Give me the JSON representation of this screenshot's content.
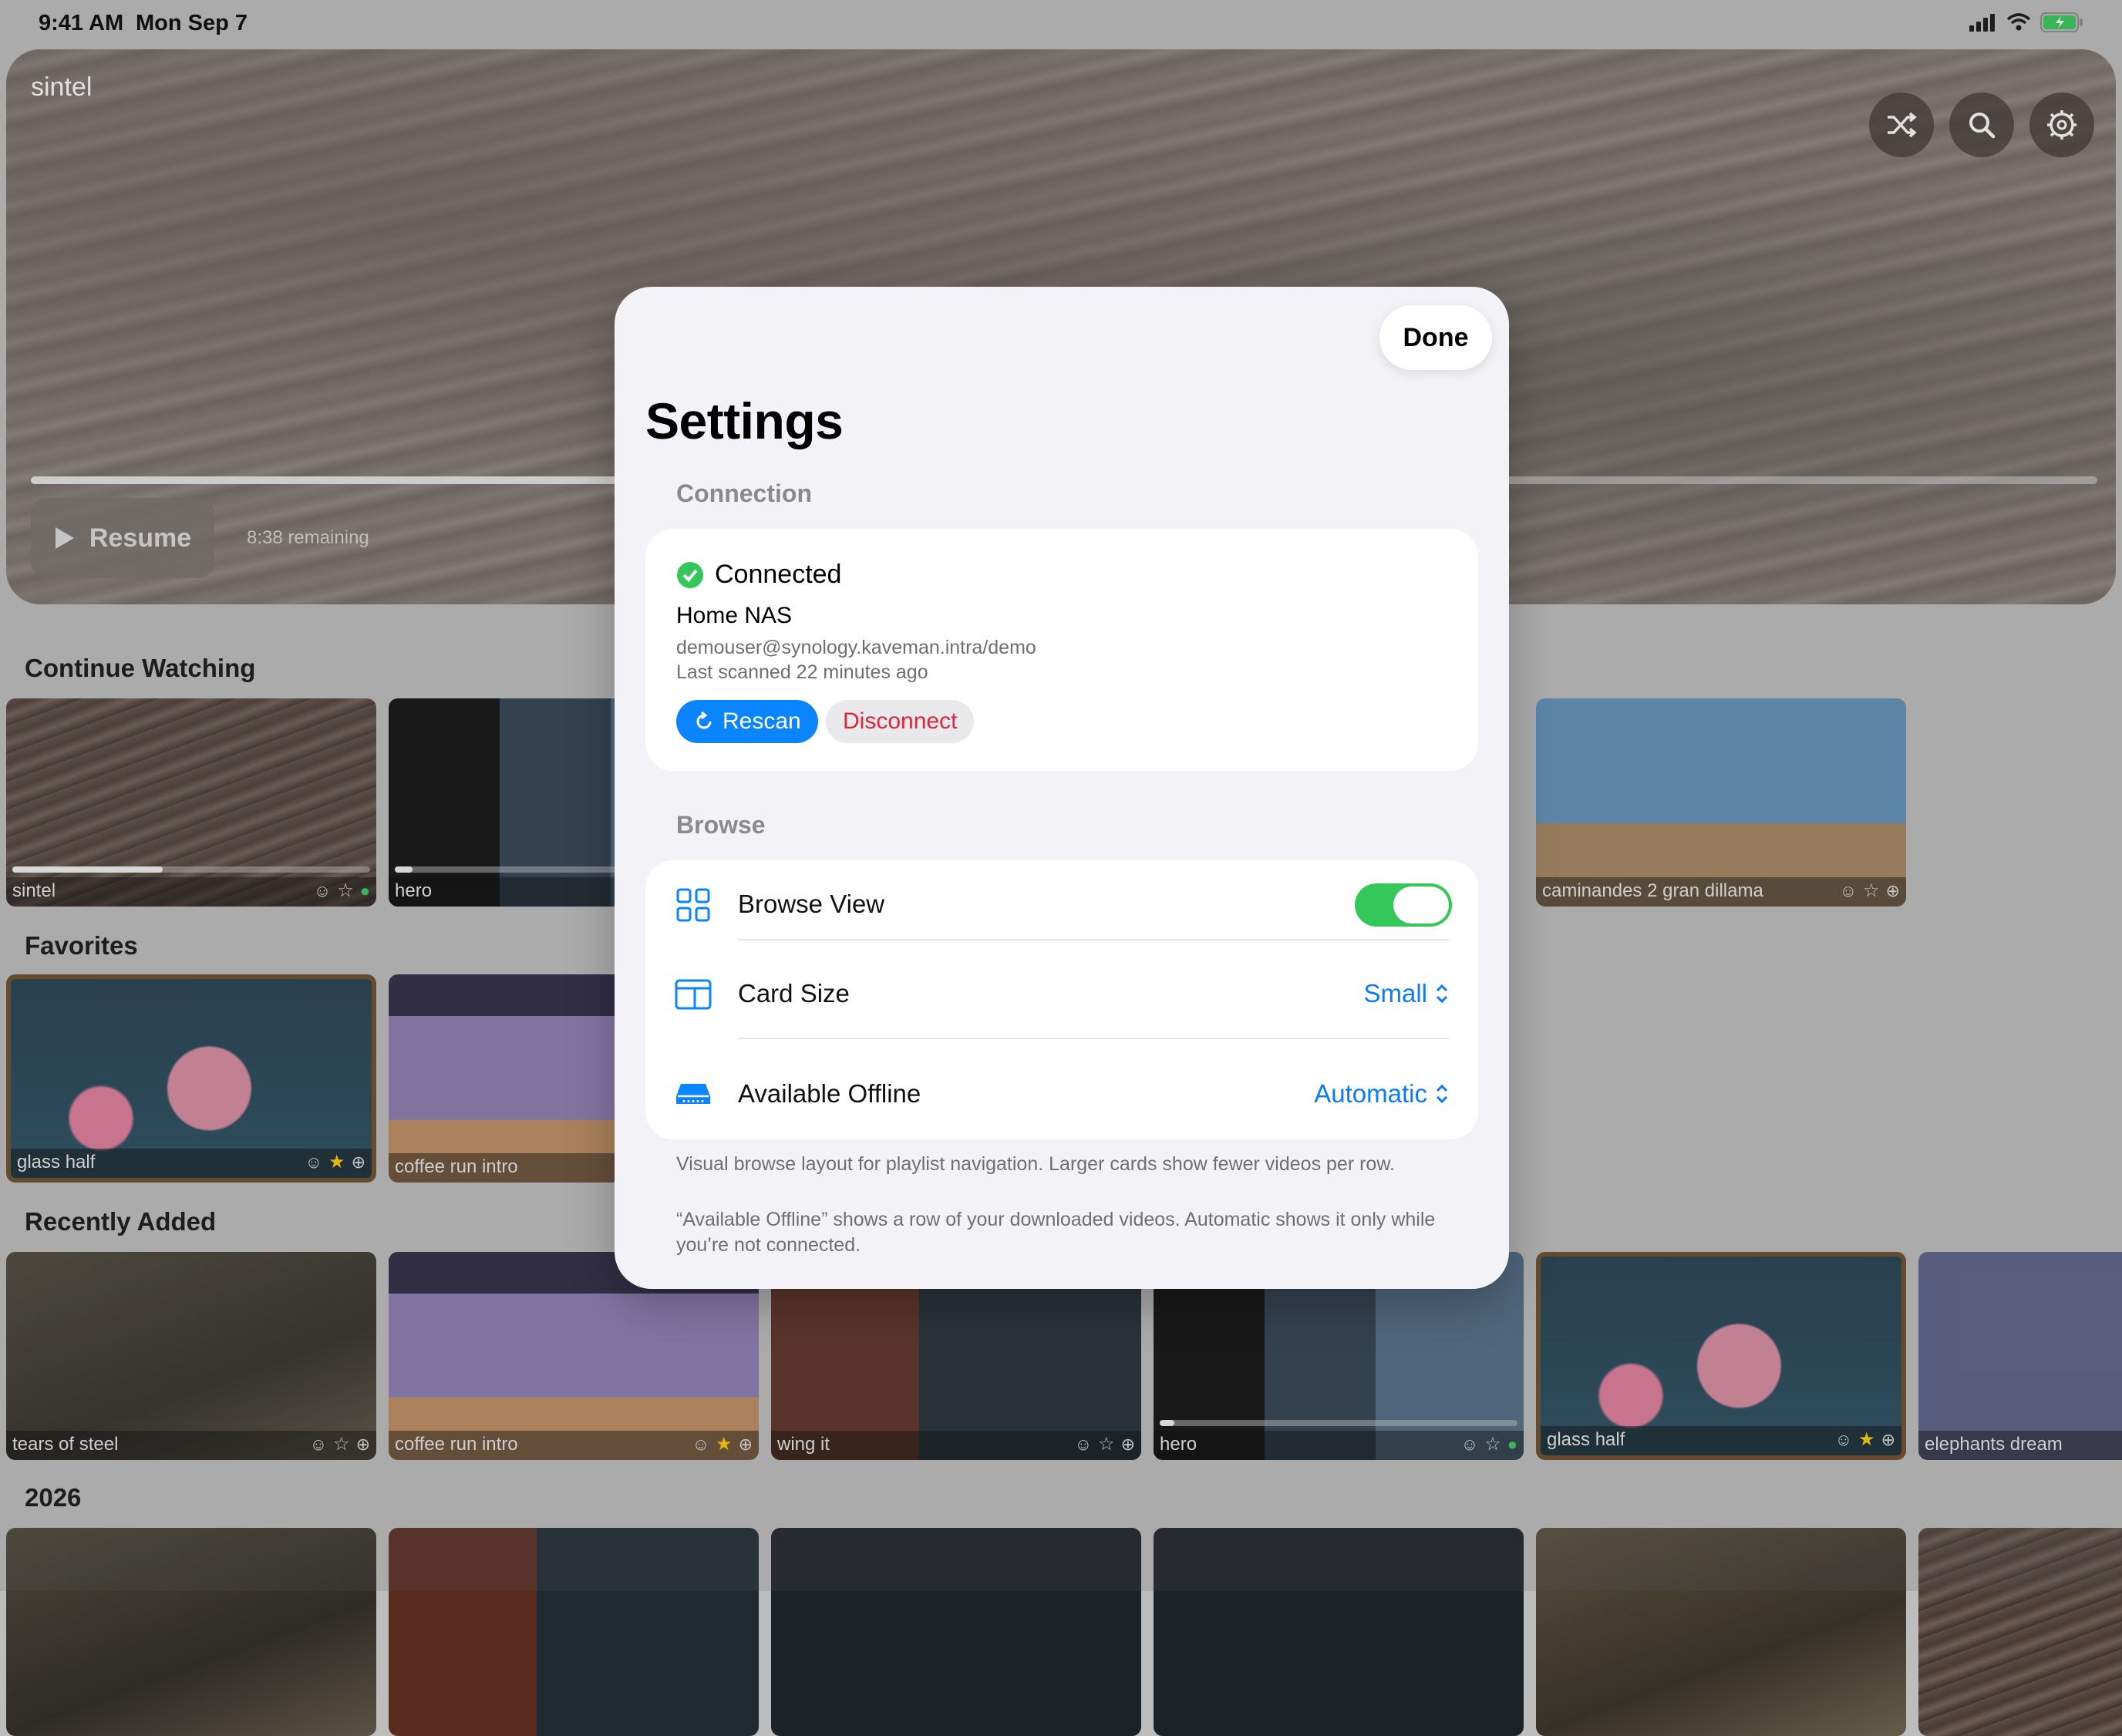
{
  "status_bar": {
    "time": "9:41 AM",
    "date": "Mon Sep 7"
  },
  "hero": {
    "title": "sintel",
    "resume_label": "Resume",
    "remaining": "8:38 remaining",
    "progress": 0.62,
    "buttons": [
      "shuffle-icon",
      "search-icon",
      "gear-icon"
    ]
  },
  "shelves": {
    "continue_watching": {
      "title": "Continue Watching",
      "items": [
        {
          "label": "sintel",
          "progress": 0.42
        },
        {
          "label": "hero",
          "progress": 0.05
        },
        {
          "label": "caminandes 2 gran dillama"
        }
      ]
    },
    "favorites": {
      "title": "Favorites",
      "items": [
        {
          "label": "glass half"
        },
        {
          "label": "coffee run intro"
        }
      ]
    },
    "recently_added": {
      "title": "Recently Added",
      "items": [
        {
          "label": "tears of steel"
        },
        {
          "label": "coffee run intro"
        },
        {
          "label": "wing it"
        },
        {
          "label": "hero"
        },
        {
          "label": "glass half"
        },
        {
          "label": "elephants dream"
        }
      ]
    },
    "year": {
      "title": "2026"
    }
  },
  "settings": {
    "title": "Settings",
    "done_label": "Done",
    "connection": {
      "header": "Connection",
      "status": "Connected",
      "server_name": "Home NAS",
      "address": "demouser@synology.kaveman.intra/demo",
      "last_scanned": "Last scanned 22 minutes ago",
      "rescan_label": "Rescan",
      "disconnect_label": "Disconnect"
    },
    "browse": {
      "header": "Browse",
      "browse_view_label": "Browse View",
      "browse_view_on": true,
      "card_size_label": "Card Size",
      "card_size_value": "Small",
      "offline_label": "Available Offline",
      "offline_value": "Automatic",
      "footnote_1": "Visual browse layout for playlist navigation. Larger cards show fewer videos per row.",
      "footnote_2": "“Available Offline” shows a row of your downloaded videos. Automatic shows it only while you’re not connected."
    }
  },
  "colors": {
    "accent": "#0a84ff",
    "toggle_on": "#34c759",
    "destructive": "#e0243a"
  }
}
